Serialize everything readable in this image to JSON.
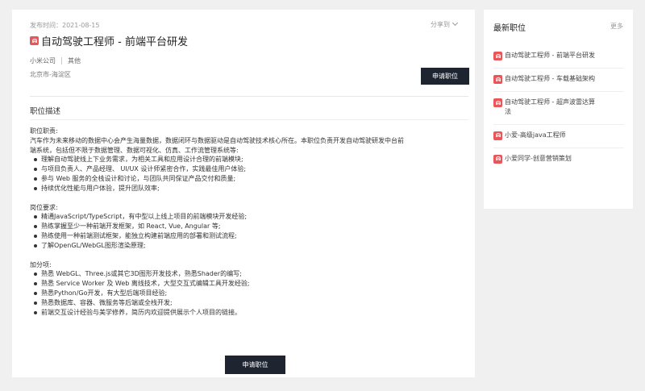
{
  "job": {
    "date": "发布时间：2021-08-15",
    "share": "分享到",
    "title": "自动驾驶工程师 - 前端平台研发",
    "company": "小米公司",
    "category": "其他",
    "location": "北京市-海淀区",
    "apply_label": "申请职位"
  },
  "section_title": "职位描述",
  "description": {
    "duties_title": "职位职责:",
    "duties_intro_1": "汽车作为未来移动的数据中心会产生海量数据，数据闭环与数据驱动是自动驾驶技术核心所在。本职位负责开发自动驾驶研发中台前",
    "duties_intro_2": "端系统，包括但不限于数据管理、数据可视化、仿真、工作流管理系统等:",
    "duties": [
      "理解自动驾驶线上下业务需求，为相关工具和应用设计合理的前端模块;",
      "与项目负责人、产品经理、 UI/UX 设计师紧密合作，实践最佳用户体验;",
      "参与 Web 服务的全栈设计和讨论，与团队共同保证产品交付和质量;",
      "持续优化性能与用户体验，提升团队效率;"
    ],
    "req_title": "岗位要求:",
    "requirements": [
      "精通JavaScript/TypeScript，有中型以上线上项目的前端模块开发经验;",
      "熟练掌握至少一种前端开发框架，如 React, Vue, Angular 等;",
      "熟练使用一种前端测试框架，能独立构建前端应用的部署和测试流程;",
      "了解OpenGL/WebGL图形渲染原理;"
    ],
    "bonus_title": "加分项:",
    "bonus": [
      "熟悉 WebGL、Three.js或其它3D图形开发技术，熟悉Shader的编写;",
      "熟悉 Service Worker 及 Web 离线技术，大型交互式编辑工具开发经验;",
      "熟悉Python/Go开发，有大型后端项目经验;",
      "熟悉数据库、容器、微服务等后端或全栈开发;",
      "前端交互设计经验与美学修养，简历内欢迎提供展示个人项目的链接。"
    ]
  },
  "sidebar": {
    "title": "最新职位",
    "more": "更多",
    "items": [
      {
        "label": "自动驾驶工程师 - 前端平台研发"
      },
      {
        "label": "自动驾驶工程师 - 车载基础架构"
      },
      {
        "label": "自动驾驶工程师 - 超声波雷达算法"
      },
      {
        "label": "小爱-高级java工程师"
      },
      {
        "label": "小爱同学-创意营销策划"
      }
    ]
  },
  "colors": {
    "badge": "#e8565a",
    "button": "#1e2530",
    "background": "#f0f0f0"
  },
  "icons": {
    "job_badge": "job-badge-icon",
    "share_chevron": "chevron-down-icon"
  }
}
